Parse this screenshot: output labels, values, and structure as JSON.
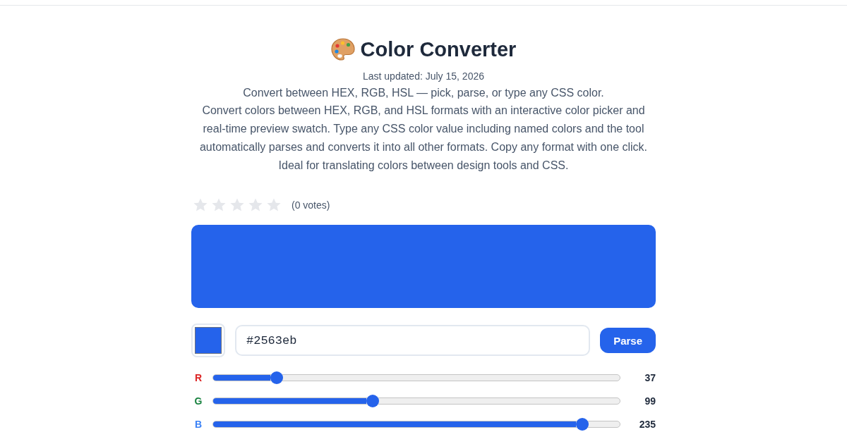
{
  "title": "Color Converter",
  "last_updated": "Last updated: July 15, 2026",
  "tagline": "Convert between HEX, RGB, HSL — pick, parse, or type any CSS color.",
  "description": "Convert colors between HEX, RGB, and HSL formats with an interactive color picker and real-time preview swatch. Type any CSS color value including named colors and the tool automatically parses and converts it into all other formats. Copy any format with one click. Ideal for translating colors between design tools and CSS.",
  "rating": {
    "stars": 0,
    "votes": "(0 votes)"
  },
  "color_input": {
    "value": "#2563eb"
  },
  "parse_button": "Parse",
  "channels": [
    {
      "name": "R",
      "color": "#dc2626",
      "level": 0.145,
      "reading": "37"
    },
    {
      "name": "G",
      "color": "#15803d",
      "level": 0.388,
      "reading": "99"
    },
    {
      "name": "B",
      "color": "#3b82f6",
      "level": 0.922,
      "reading": "235"
    }
  ]
}
